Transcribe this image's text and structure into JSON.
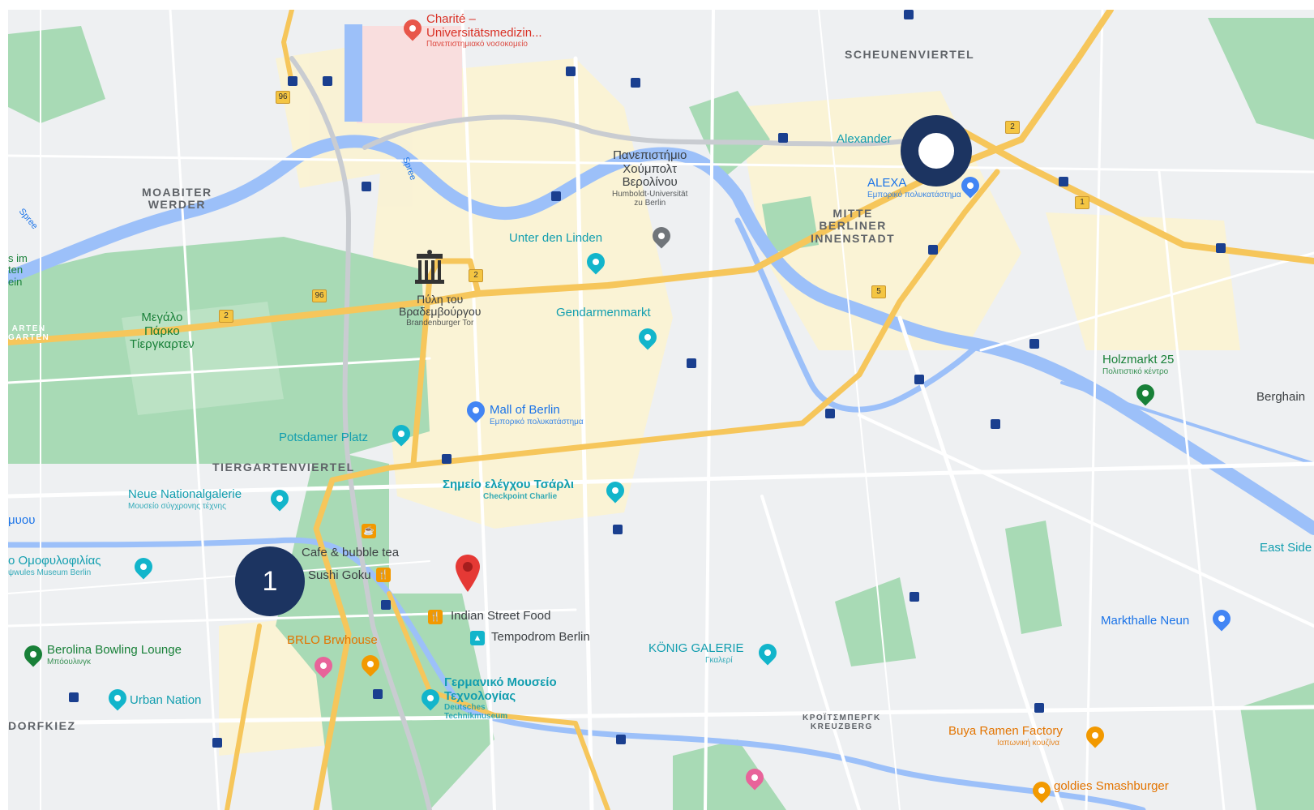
{
  "map": {
    "districts": [
      {
        "id": "scheunenviertel",
        "text": "SCHEUNENVIERTEL"
      },
      {
        "id": "moabiter-werder",
        "text": "MOABITER\nWERDER"
      },
      {
        "id": "berliner-innenstadt",
        "text": "MITTE\nBERLINER\nINNENSTADT"
      },
      {
        "id": "tiergartenviertel",
        "text": "TIERGARTENVIERTEL"
      },
      {
        "id": "dorfkiez",
        "text": "DORFKIEZ"
      },
      {
        "id": "kreuzberg",
        "text": "ΚΡΟΪΤΣΜΠΕΡΓΚ\nKREUZBERG"
      }
    ],
    "places": {
      "charite": {
        "name": "Charité –\nUniversitätsmedizin...",
        "sub": "Πανεπιστημιακό νοσοκομείο"
      },
      "humboldt": {
        "name": "Πανεπιστήμιο\nΧούμπολτ\nΒερολίνου",
        "sub": "Humboldt-Universität\nzu Berlin"
      },
      "alexanderplatz": {
        "name": "Alexander"
      },
      "alexa": {
        "name": "ALEXA",
        "sub": "Εμπορικό πολυκατάστημα"
      },
      "unter_den_linden": {
        "name": "Unter den Linden"
      },
      "brandenburger": {
        "name": "Πύλη του\nΒραδεμβούργου",
        "sub": "Brandenburger Tor"
      },
      "gendarmenmarkt": {
        "name": "Gendarmenmarkt"
      },
      "mall_of_berlin": {
        "name": "Mall of Berlin",
        "sub": "Εμπορικό πολυκατάστημα"
      },
      "potsdamer_platz": {
        "name": "Potsdamer Platz"
      },
      "checkpoint": {
        "name": "Σημείο ελέγχου Τσάρλι",
        "sub": "Checkpoint Charlie"
      },
      "neue_nationalgalerie": {
        "name": "Neue Nationalgalerie",
        "sub": "Μουσείο σύγχρονης τέχνης"
      },
      "tiergarten": {
        "name": "Μεγάλο\nΠάρκο\nΤίεργκαρτεν"
      },
      "cafe_bubble": {
        "name": "Cafe & bubble tea"
      },
      "sushi_goku": {
        "name": "Sushi Goku"
      },
      "indian_street_food": {
        "name": "Indian Street Food"
      },
      "tempodrom": {
        "name": "Tempodrom Berlin"
      },
      "brlo": {
        "name": "BRLO Brwhouse"
      },
      "technikmuseum": {
        "name": "Γερμανικό Μουσείο\nΤεχνολογίας",
        "sub": "Deutsches\nTechnikmuseum"
      },
      "konig_galerie": {
        "name": "KÖNIG GALERIE",
        "sub": "Γκαλερί"
      },
      "holzmarkt": {
        "name": "Holzmarkt 25",
        "sub": "Πολιτιστικό κέντρο"
      },
      "berghain": {
        "name": "Berghain"
      },
      "east_side": {
        "name": "East Side"
      },
      "markthalle": {
        "name": "Markthalle Neun"
      },
      "berolina": {
        "name": "Berolina Bowling Lounge",
        "sub": "Μπόουλινγκ"
      },
      "urban_nation": {
        "name": "Urban Nation"
      },
      "bona_ramen": {
        "name": "Buya Ramen Factory",
        "sub": "Ιαπωνική κουζίνα"
      },
      "goodies": {
        "name": "goldies Smashburger"
      },
      "spree": {
        "name": "Spree"
      },
      "jouy": {
        "name": "μυου"
      },
      "museum_left": {
        "name": "ο Ομοφυλοφιλίας",
        "sub": "ψwules Museum Berlin"
      },
      "s_im": {
        "name": "s im\nten\nein"
      },
      "garten_left": {
        "name": "ARTEN\nGARTEN"
      }
    },
    "road_numbers": [
      "96",
      "2",
      "1",
      "5"
    ],
    "markers": [
      {
        "id": "marker-1",
        "label": "1",
        "color": "#1c3461"
      },
      {
        "id": "marker-2",
        "label": "",
        "color": "#1c3461"
      }
    ],
    "colors": {
      "background": "#eef0f2",
      "park": "#a8dab5",
      "water": "#9cc0f9",
      "highway": "#f6c65b",
      "built": "#fdf6d8",
      "marker": "#1c3461",
      "pin_red": "#e53935"
    }
  }
}
